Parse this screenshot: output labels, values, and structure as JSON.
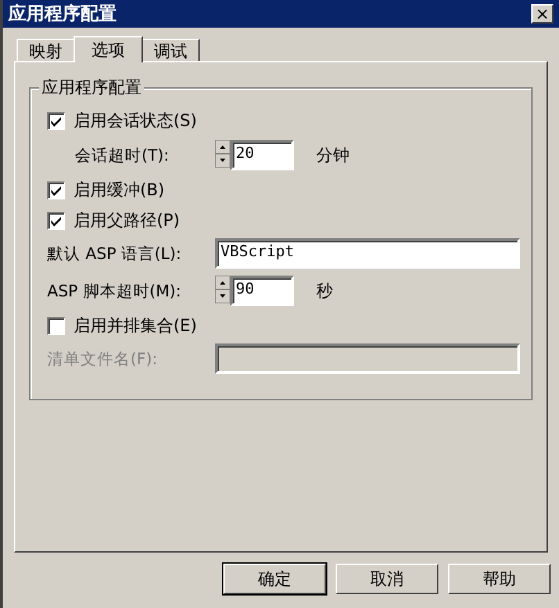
{
  "window": {
    "title": "应用程序配置",
    "close": "×"
  },
  "tabs": [
    {
      "label": "映射",
      "selected": false
    },
    {
      "label": "选项",
      "selected": true
    },
    {
      "label": "调试",
      "selected": false
    }
  ],
  "group": {
    "title": "应用程序配置"
  },
  "rows": [
    {
      "kind": "checkbox",
      "label": "启用会话状态(S)",
      "checked": true,
      "disabled": false
    },
    {
      "kind": "spinner",
      "label": "会话超时(T):",
      "value": "20",
      "unit": "分钟",
      "indent": true,
      "disabled": false
    },
    {
      "kind": "checkbox",
      "label": "启用缓冲(B)",
      "checked": true,
      "disabled": false
    },
    {
      "kind": "checkbox",
      "label": "启用父路径(P)",
      "checked": true,
      "disabled": false
    },
    {
      "kind": "text",
      "label": "默认 ASP 语言(L):",
      "value": "VBScript",
      "disabled": false
    },
    {
      "kind": "spinner",
      "label": "ASP 脚本超时(M):",
      "value": "90",
      "unit": "秒",
      "indent": false,
      "disabled": false
    },
    {
      "kind": "checkbox",
      "label": "启用并排集合(E)",
      "checked": false,
      "disabled": false
    },
    {
      "kind": "text",
      "label": "清单文件名(F):",
      "value": "",
      "disabled": true
    }
  ],
  "buttons": [
    {
      "label": "确定",
      "default": true
    },
    {
      "label": "取消",
      "default": false
    },
    {
      "label": "帮助",
      "default": false
    }
  ]
}
